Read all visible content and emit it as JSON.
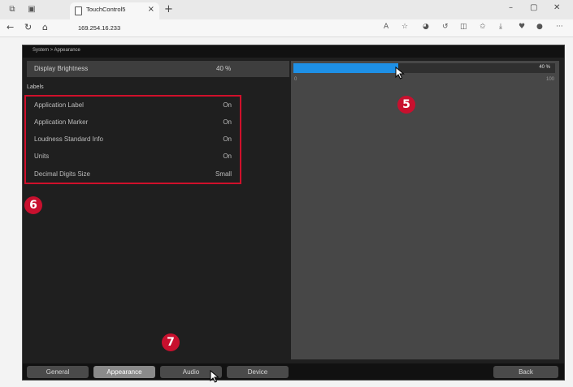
{
  "browser": {
    "tab_title": "TouchControl5",
    "url": "169.254.16.233",
    "new_tab": "+",
    "close_tab": "×"
  },
  "app": {
    "breadcrumb": "System > Appearance",
    "brightness": {
      "label": "Display Brightness",
      "value": "40 %"
    },
    "slider": {
      "percent_label": "40 %",
      "value": 40,
      "min": "0",
      "max": "100"
    },
    "labels_section": {
      "heading": "Labels",
      "rows": [
        {
          "label": "Application Label",
          "value": "On"
        },
        {
          "label": "Application Marker",
          "value": "On"
        },
        {
          "label": "Loudness Standard Info",
          "value": "On"
        },
        {
          "label": "Units",
          "value": "On"
        },
        {
          "label": "Decimal Digits Size",
          "value": "Small"
        }
      ]
    },
    "bottom_tabs": [
      "General",
      "Appearance",
      "Audio",
      "Device"
    ],
    "active_tab": "Appearance",
    "back_label": "Back"
  },
  "callouts": [
    "5",
    "6",
    "7"
  ],
  "colors": {
    "accent": "#1e90e6",
    "callout": "#c8102e",
    "highlight_border": "#d0102b"
  }
}
